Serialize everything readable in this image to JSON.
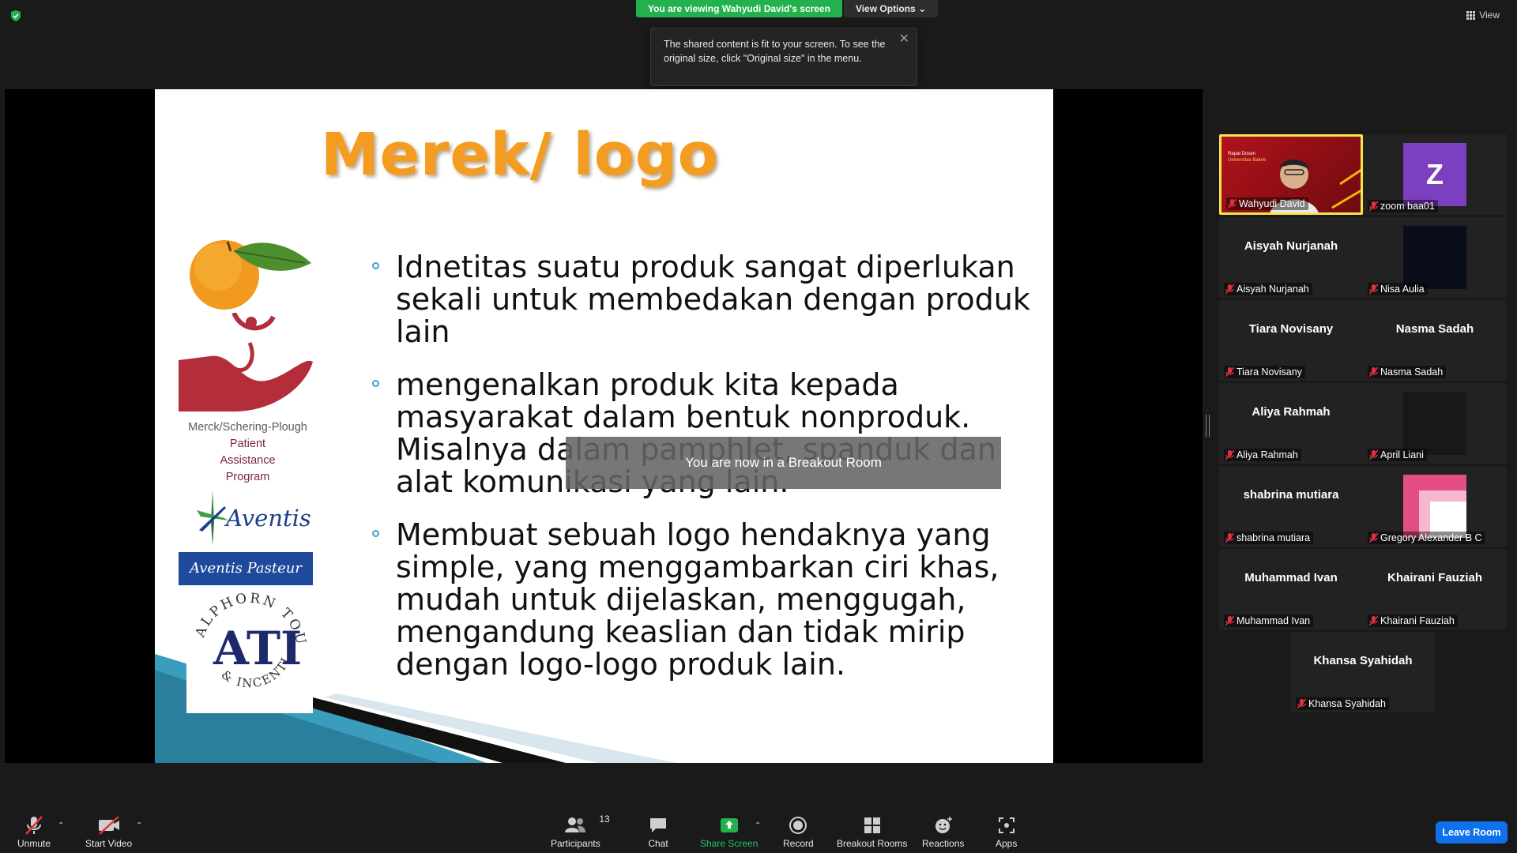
{
  "banner": {
    "viewing_text": "You are viewing Wahyudi David's screen",
    "view_options_label": "View Options"
  },
  "tooltip": {
    "text": "The shared content is fit to your screen. To see the original size, click \"Original size\" in the menu."
  },
  "view_button_label": "View",
  "slide": {
    "title": "Merek/  logo",
    "bullets": [
      "Idnetitas suatu produk sangat diperlukan sekali untuk membedakan dengan produk lain",
      "mengenalkan produk kita kepada masyarakat dalam bentuk nonproduk. Misalnya dalam pamphlet, spanduk dan alat komunikasi yang lain.",
      "Membuat sebuah logo hendaknya yang simple, yang menggambarkan ciri khas, mudah untuk dijelaskan, menggugah, mengandung keaslian dan tidak mirip dengan logo-logo produk lain."
    ],
    "logos": {
      "merck_line1": "Merck/Schering-Plough",
      "merck_line2": "Patient",
      "merck_line3": "Assistance",
      "merck_line4": "Program",
      "aventis": "Aventis",
      "aventis_pasteur": "Aventis Pasteur",
      "ati": "ATI",
      "ati_ring_top": "ALPHORN TOURS",
      "ati_ring_bottom": "& INCENTIVES"
    }
  },
  "breakout_notice": "You are now in a Breakout Room",
  "participants": [
    {
      "display": "video",
      "label": "Wahyudi David",
      "active": true
    },
    {
      "display": "avatar",
      "avatar_letter": "Z",
      "label": "zoom baa01"
    },
    {
      "display": "name",
      "name": "Aisyah Nurjanah",
      "label": "Aisyah Nurjanah"
    },
    {
      "display": "dark",
      "label": "Nisa Aulia"
    },
    {
      "display": "name",
      "name": "Tiara Novisany",
      "label": "Tiara Novisany"
    },
    {
      "display": "name",
      "name": "Nasma Sadah",
      "label": "Nasma Sadah"
    },
    {
      "display": "name",
      "name": "Aliya Rahmah",
      "label": "Aliya Rahmah"
    },
    {
      "display": "dark",
      "label": "April Liani"
    },
    {
      "display": "name",
      "name": "shabrina mutiara",
      "label": "shabrina mutiara"
    },
    {
      "display": "pink",
      "label": "Gregory Alexander B C"
    },
    {
      "display": "name",
      "name": "Muhammad Ivan",
      "label": "Muhammad Ivan"
    },
    {
      "display": "name",
      "name": "Khairani Fauziah",
      "label": "Khairani Fauziah"
    },
    {
      "display": "name",
      "name": "Khansa Syahidah",
      "label": "Khansa Syahidah"
    }
  ],
  "video_tile_text": {
    "line1": "Rapat Dosen",
    "line2": "Universitas Bakrie"
  },
  "toolbar": {
    "unmute": "Unmute",
    "start_video": "Start Video",
    "participants": "Participants",
    "participants_count": "13",
    "chat": "Chat",
    "share_screen": "Share Screen",
    "record": "Record",
    "breakout_rooms": "Breakout Rooms",
    "reactions": "Reactions",
    "apps": "Apps",
    "leave_room": "Leave Room"
  },
  "colors": {
    "green_banner": "#22b14c",
    "leave_blue": "#0e71eb",
    "title_orange": "#f39c1f",
    "active_speaker": "#f5e44a",
    "muted_red": "#e0323c"
  }
}
